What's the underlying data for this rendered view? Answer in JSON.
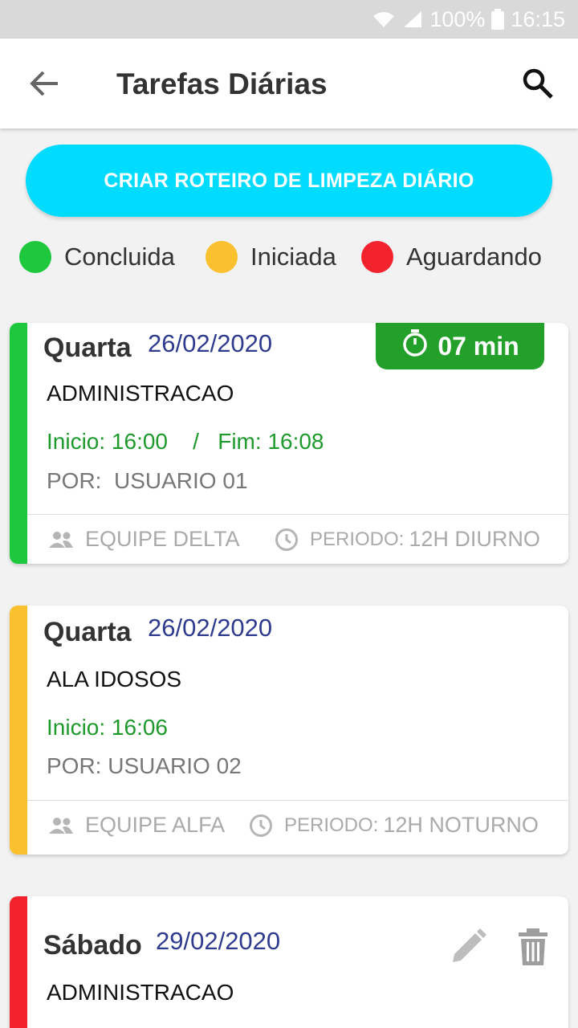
{
  "status_bar": {
    "battery": "100%",
    "time": "16:15"
  },
  "header": {
    "title": "Tarefas Diárias"
  },
  "cta": {
    "label": "CRIAR ROTEIRO DE LIMPEZA DIÁRIO",
    "color": "#00dcff"
  },
  "legend": [
    {
      "label": "Concluida",
      "color": "#1ec83c"
    },
    {
      "label": "Iniciada",
      "color": "#fbc02d"
    },
    {
      "label": "Aguardando",
      "color": "#f2232d"
    }
  ],
  "tasks": [
    {
      "status_color": "#1ec83c",
      "day": "Quarta",
      "date": "26/02/2020",
      "timer": "07 min",
      "place": "ADMINISTRACAO",
      "times": "Inicio: 16:00    /   Fim: 16:08",
      "by": "POR:  USUARIO 01",
      "team": "EQUIPE DELTA",
      "period_label": "PERIODO:",
      "period_value": "12H DIURNO"
    },
    {
      "status_color": "#fbc02d",
      "day": "Quarta",
      "date": "26/02/2020",
      "place": "ALA IDOSOS",
      "times": "Inicio: 16:06",
      "by": "POR: USUARIO 02",
      "team": "EQUIPE ALFA",
      "period_label": "PERIODO:",
      "period_value": "12H NOTURNO"
    },
    {
      "status_color": "#f2232d",
      "day": "Sábado",
      "date": "29/02/2020",
      "place": "ADMINISTRACAO"
    }
  ]
}
